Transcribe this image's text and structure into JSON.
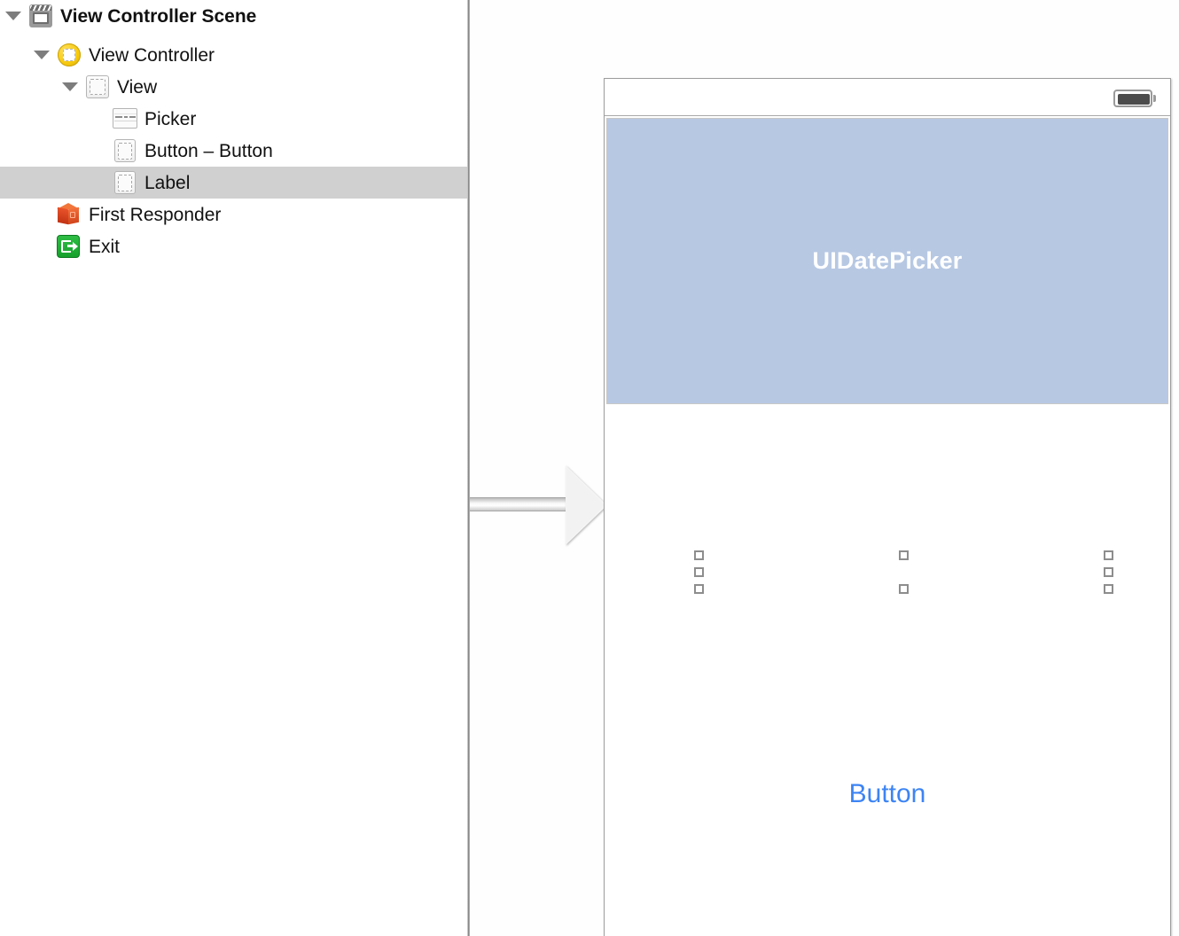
{
  "outline": {
    "rows": [
      {
        "label": "View Controller Scene",
        "icon": "scene-clapperboard-icon",
        "depth": 0,
        "expanded": true,
        "selected": false,
        "bold": true
      },
      {
        "label": "View Controller",
        "icon": "view-controller-icon",
        "depth": 1,
        "expanded": true,
        "selected": false,
        "bold": false
      },
      {
        "label": "View",
        "icon": "view-icon",
        "depth": 2,
        "expanded": true,
        "selected": false,
        "bold": false
      },
      {
        "label": "Picker",
        "icon": "picker-icon",
        "depth": 3,
        "expanded": false,
        "selected": false,
        "bold": false
      },
      {
        "label": "Button – Button",
        "icon": "button-icon",
        "depth": 3,
        "expanded": false,
        "selected": false,
        "bold": false
      },
      {
        "label": "Label",
        "icon": "label-icon",
        "depth": 3,
        "expanded": false,
        "selected": true,
        "bold": false
      },
      {
        "label": "First Responder",
        "icon": "first-responder-cube-icon",
        "depth": 1,
        "expanded": false,
        "selected": false,
        "bold": false
      },
      {
        "label": "Exit",
        "icon": "exit-icon",
        "depth": 1,
        "expanded": false,
        "selected": false,
        "bold": false
      }
    ],
    "selection_color": "#d0d0d0"
  },
  "canvas": {
    "entry_arrow": "initial-view-controller-arrow",
    "device": {
      "status_bar": {
        "battery_icon": "battery-icon"
      },
      "date_picker": {
        "label": "UIDatePicker",
        "fill_color": "#b7c8e3",
        "text_color": "#ffffff"
      },
      "selected_label": {
        "name": "Label",
        "text": "",
        "handle_count": 8
      },
      "button": {
        "title": "Button",
        "color": "#3d84f4"
      }
    }
  }
}
